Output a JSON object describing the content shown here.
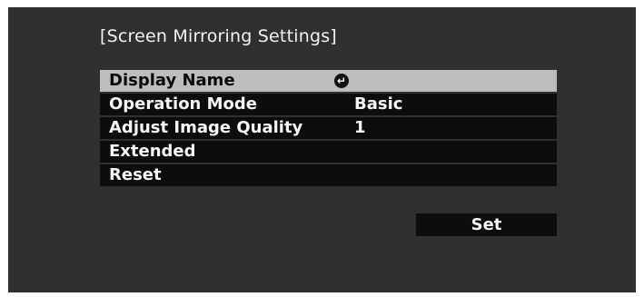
{
  "title": "[Screen Mirroring Settings]",
  "menu": {
    "items": [
      {
        "label": "Display Name",
        "value": "",
        "icon": "enter-icon",
        "selected": true
      },
      {
        "label": "Operation Mode",
        "value": "Basic"
      },
      {
        "label": "Adjust Image Quality",
        "value": "1"
      },
      {
        "label": "Extended",
        "value": ""
      },
      {
        "label": "Reset",
        "value": ""
      }
    ]
  },
  "set_button": {
    "label": "Set"
  },
  "colors": {
    "panel_bg": "#303030",
    "row_bg": "#0d0d0d",
    "selected_bg": "#bdbdbd"
  }
}
